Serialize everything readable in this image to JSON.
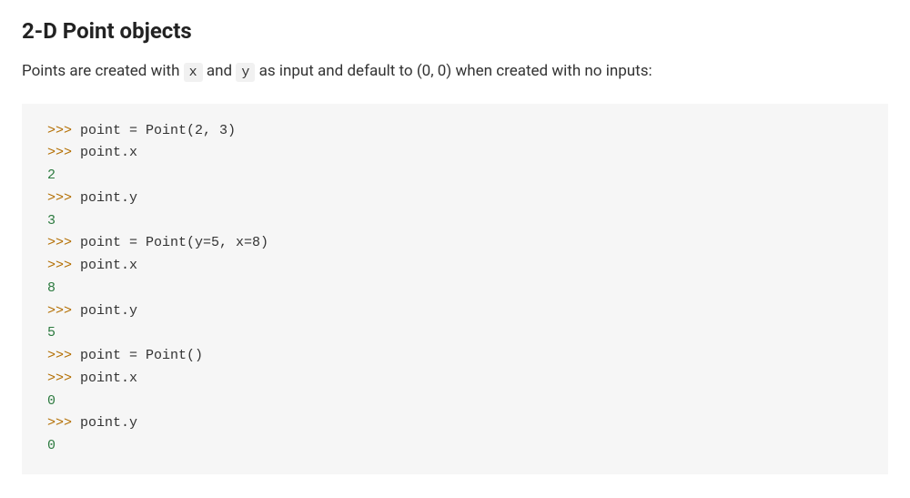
{
  "heading": "2-D Point objects",
  "intro": {
    "part1": "Points are created with ",
    "code1": "x",
    "part2": " and ",
    "code2": "y",
    "part3": " as input and default to (0, 0) when created with no inputs:"
  },
  "code": {
    "prompt": ">>> ",
    "lines": [
      {
        "type": "input",
        "text": "point = Point(2, 3)"
      },
      {
        "type": "input",
        "text": "point.x"
      },
      {
        "type": "output",
        "text": "2"
      },
      {
        "type": "input",
        "text": "point.y"
      },
      {
        "type": "output",
        "text": "3"
      },
      {
        "type": "input",
        "text": "point = Point(y=5, x=8)"
      },
      {
        "type": "input",
        "text": "point.x"
      },
      {
        "type": "output",
        "text": "8"
      },
      {
        "type": "input",
        "text": "point.y"
      },
      {
        "type": "output",
        "text": "5"
      },
      {
        "type": "input",
        "text": "point = Point()"
      },
      {
        "type": "input",
        "text": "point.x"
      },
      {
        "type": "output",
        "text": "0"
      },
      {
        "type": "input",
        "text": "point.y"
      },
      {
        "type": "output",
        "text": "0"
      }
    ]
  }
}
